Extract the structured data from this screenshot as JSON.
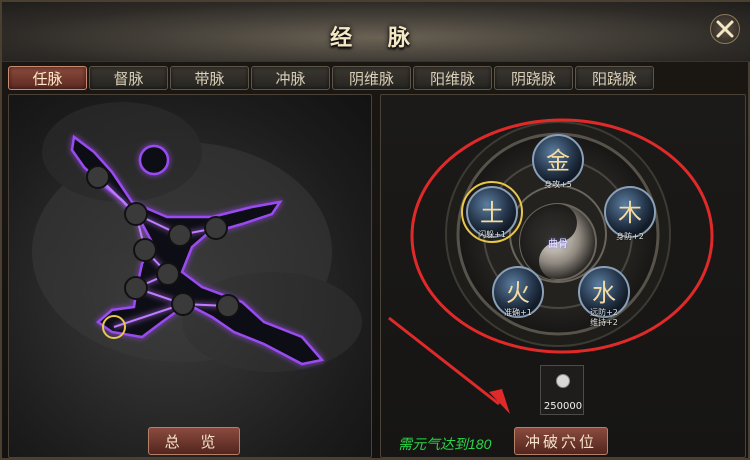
{
  "window": {
    "title": "经 脉"
  },
  "tabs": [
    {
      "label": "任脉",
      "active": true
    },
    {
      "label": "督脉",
      "active": false
    },
    {
      "label": "带脉",
      "active": false
    },
    {
      "label": "冲脉",
      "active": false
    },
    {
      "label": "阴维脉",
      "active": false
    },
    {
      "label": "阳维脉",
      "active": false
    },
    {
      "label": "阴跷脉",
      "active": false
    },
    {
      "label": "阳跷脉",
      "active": false
    }
  ],
  "left_panel": {
    "overview_label": "总 览"
  },
  "wheel": {
    "center_label": "曲骨",
    "elements": {
      "metal": {
        "glyph": "金",
        "stat": "身攻+5"
      },
      "wood": {
        "glyph": "木",
        "stat": "身防+2"
      },
      "water": {
        "glyph": "水",
        "stat_1": "远防+2",
        "stat_2": "维持+2"
      },
      "fire": {
        "glyph": "火",
        "stat": "准确+1"
      },
      "earth": {
        "glyph": "土",
        "stat": "闪躲+1",
        "selected": true
      }
    }
  },
  "cost": {
    "icon": "silver-coin-icon",
    "value": "250000"
  },
  "requirement_text": "需元气达到180",
  "breakthrough_label": "冲破穴位",
  "colors": {
    "accent_red": "#8a4b3e",
    "meridian_purple": "#a04df0",
    "requirement_green": "#2bd64a",
    "annotation_red": "#e02a2a"
  }
}
